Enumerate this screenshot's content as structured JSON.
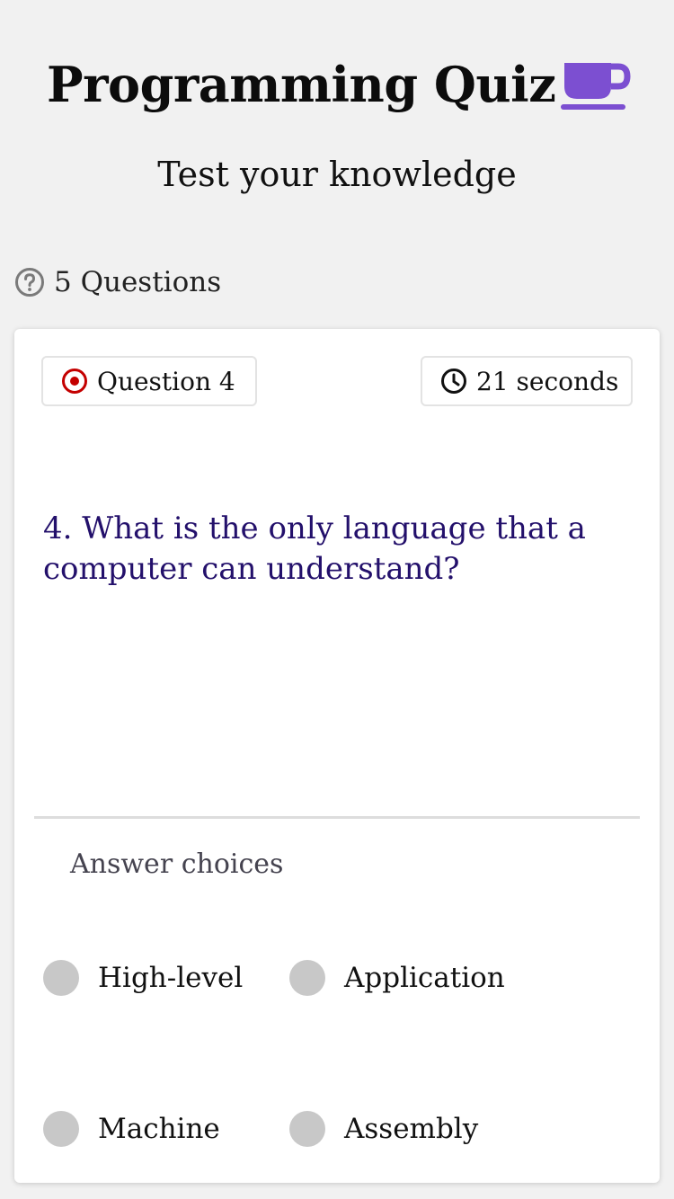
{
  "header": {
    "title": "Programming Quiz",
    "subtitle": "Test your knowledge"
  },
  "quiz_info": {
    "question_count": "5 Questions"
  },
  "card": {
    "question_chip": "Question 4",
    "timer_chip": "21 seconds",
    "question_text": "4. What is the only language that a computer can understand?",
    "answer_heading": "Answer choices",
    "choices": [
      {
        "label": "High-level"
      },
      {
        "label": "Application"
      },
      {
        "label": "Machine"
      },
      {
        "label": "Assembly"
      }
    ]
  },
  "colors": {
    "accent": "#7c4fd1",
    "question_text": "#23106b",
    "target_icon": "#c40000",
    "radio_unselected": "#c8c8c8",
    "background": "#f1f1f1"
  },
  "icons": {
    "title_icon": "coffee-cup-icon",
    "question_count_icon": "help-circle-icon",
    "question_chip_icon": "target-icon",
    "timer_chip_icon": "clock-icon"
  }
}
